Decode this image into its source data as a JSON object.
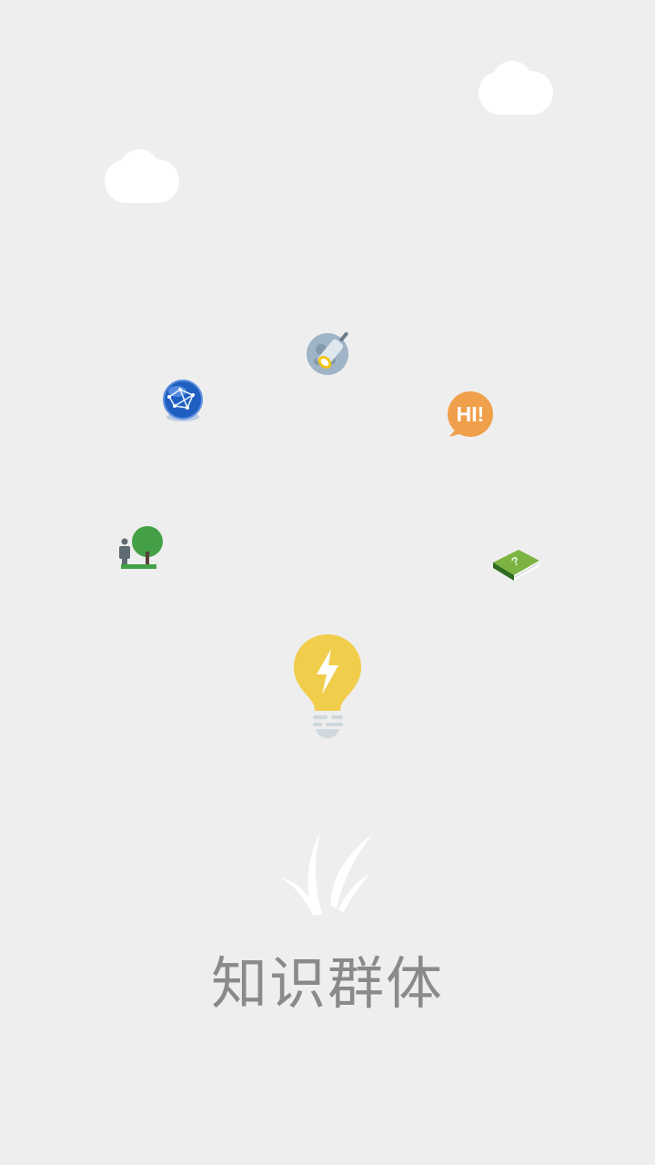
{
  "splash": {
    "app_name": "知识群体",
    "icons": {
      "cloud_right": "cloud-icon",
      "cloud_left": "cloud-icon",
      "telescope": "telescope-icon",
      "globe": "globe-network-icon",
      "hi_bubble": "hi-chat-icon",
      "tree_person": "tree-person-icon",
      "book": "question-book-icon",
      "bulb": "lightbulb-lightning-icon",
      "grass": "grass-logo-icon"
    },
    "hi_bubble_text": "HI!",
    "colors": {
      "background": "#eeeeee",
      "bulb": "#f1cd4c",
      "title": "#8a8a8a",
      "hi": "#f0a04b",
      "tree": "#43a047",
      "globe": "#1f5fbf"
    }
  }
}
